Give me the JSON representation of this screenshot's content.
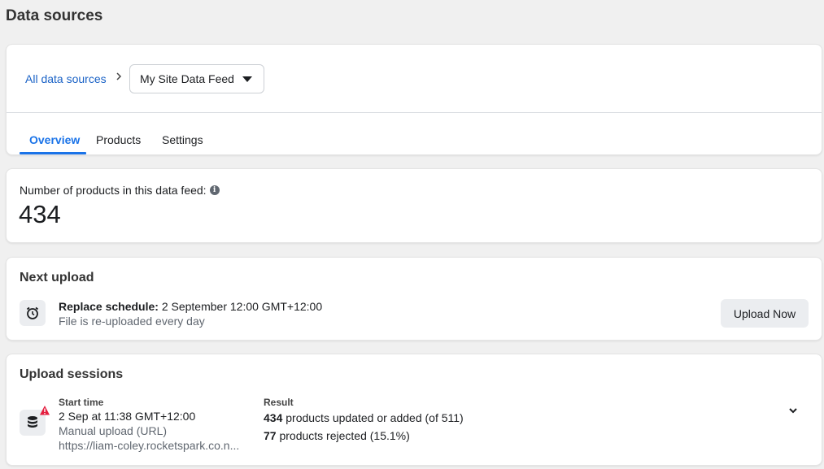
{
  "page": {
    "title": "Data sources"
  },
  "breadcrumb": {
    "root_label": "All data sources",
    "separator": ">",
    "selected_feed": "My Site Data Feed"
  },
  "tabs": [
    {
      "label": "Overview",
      "active": true
    },
    {
      "label": "Products",
      "active": false
    },
    {
      "label": "Settings",
      "active": false
    }
  ],
  "product_count": {
    "label": "Number of products in this data feed:",
    "info_icon": "info-icon",
    "value": "434"
  },
  "next_upload": {
    "title": "Next upload",
    "icon": "alarm-clock-icon",
    "schedule_label": "Replace schedule:",
    "schedule_value": "2 September 12:00 GMT+12:00",
    "frequency_text": "File is re-uploaded every day",
    "button_label": "Upload Now"
  },
  "upload_sessions": {
    "title": "Upload sessions",
    "icon": "database-icon",
    "warning_icon": "warning-icon",
    "start_time_label": "Start time",
    "start_time_value": "2 Sep at 11:38 GMT+12:00",
    "method": "Manual upload (URL)",
    "url": "https://liam-coley.rocketspark.co.n...",
    "result_label": "Result",
    "updated_count": "434",
    "updated_text": "products updated or added (of 511)",
    "rejected_count": "77",
    "rejected_text": "products rejected (15.1%)"
  },
  "colors": {
    "accent": "#1a73e8",
    "link": "#1a62c6",
    "warning": "#e41e3f"
  }
}
